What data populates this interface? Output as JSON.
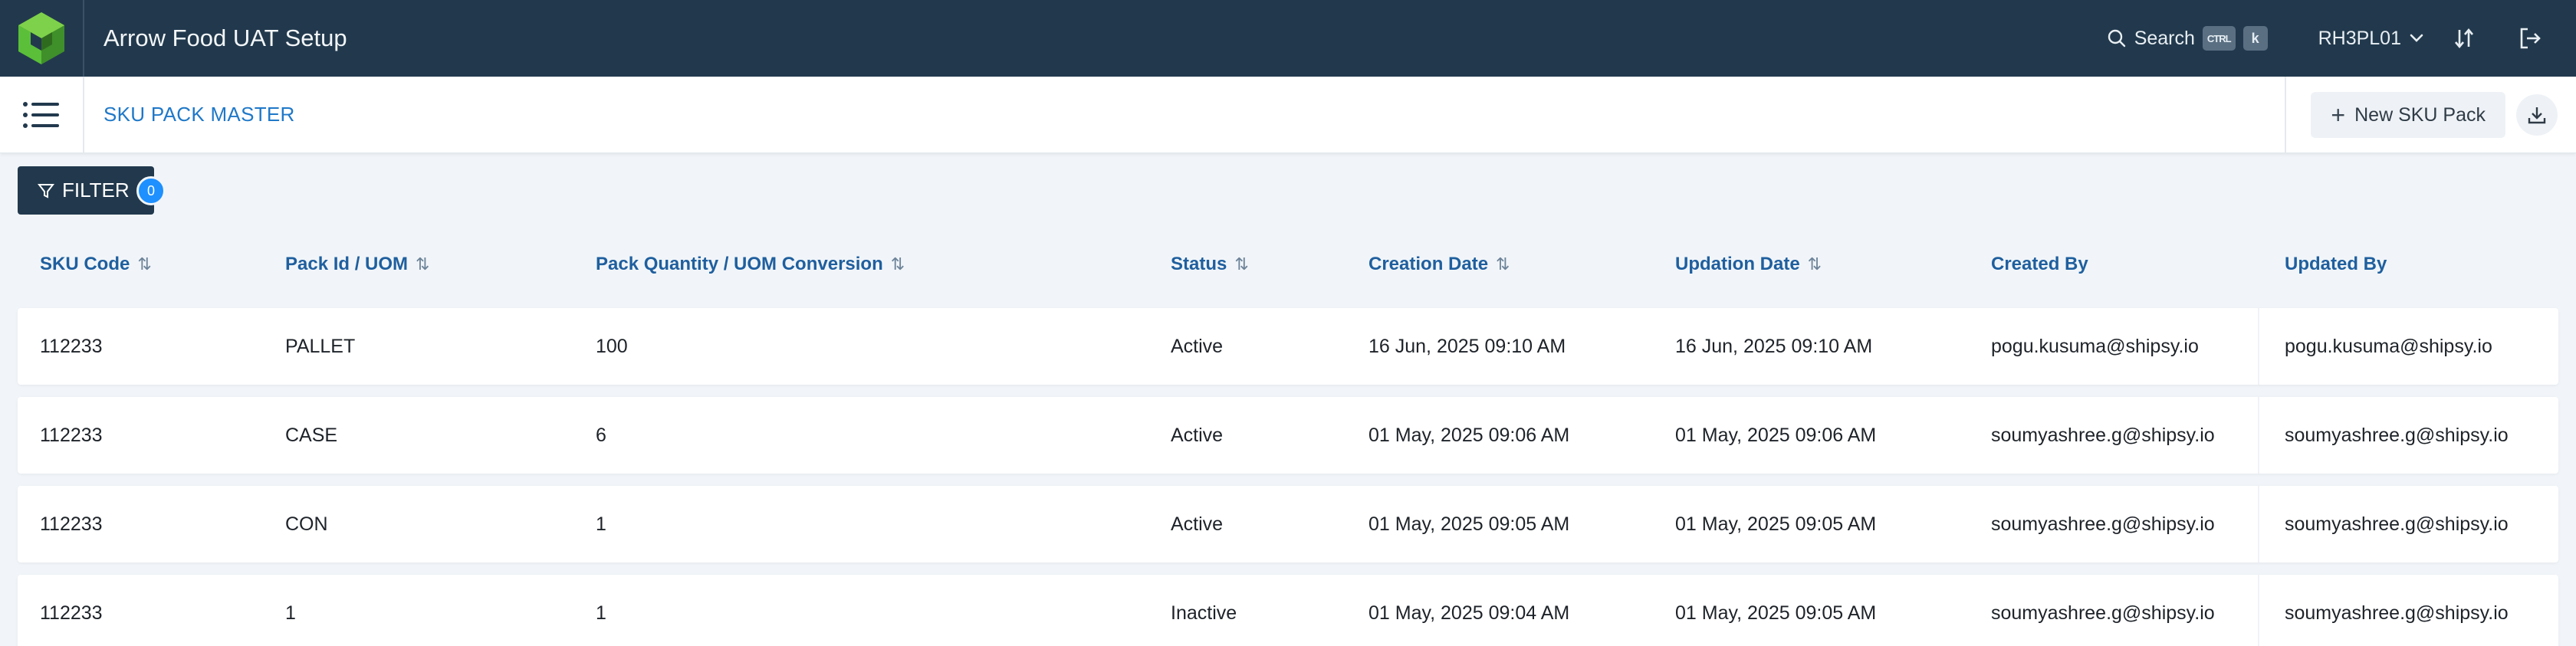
{
  "app": {
    "title": "Arrow Food UAT Setup"
  },
  "topbar": {
    "search_label": "Search",
    "shortcut_keys": [
      "CTRL",
      "k"
    ],
    "org_code": "RH3PL01"
  },
  "page": {
    "title": "SKU PACK MASTER",
    "new_button_label": "New SKU Pack"
  },
  "filter": {
    "label": "FILTER",
    "count": "0"
  },
  "table": {
    "columns": [
      "SKU Code",
      "Pack Id / UOM",
      "Pack Quantity / UOM Conversion",
      "Status",
      "Creation Date",
      "Updation Date",
      "Created By",
      "Updated By"
    ],
    "rows": [
      [
        "112233",
        "PALLET",
        "100",
        "Active",
        "16 Jun, 2025 09:10 AM",
        "16 Jun, 2025 09:10 AM",
        "pogu.kusuma@shipsy.io",
        "pogu.kusuma@shipsy.io"
      ],
      [
        "112233",
        "CASE",
        "6",
        "Active",
        "01 May, 2025 09:06 AM",
        "01 May, 2025 09:06 AM",
        "soumyashree.g@shipsy.io",
        "soumyashree.g@shipsy.io"
      ],
      [
        "112233",
        "CON",
        "1",
        "Active",
        "01 May, 2025 09:05 AM",
        "01 May, 2025 09:05 AM",
        "soumyashree.g@shipsy.io",
        "soumyashree.g@shipsy.io"
      ],
      [
        "112233",
        "1",
        "1",
        "Inactive",
        "01 May, 2025 09:04 AM",
        "01 May, 2025 09:05 AM",
        "soumyashree.g@shipsy.io",
        "soumyashree.g@shipsy.io"
      ]
    ]
  },
  "colors": {
    "topbar_bg": "#22394d",
    "accent_blue": "#1f78c8",
    "header_text": "#1f5f9e",
    "badge_blue": "#1e90ff",
    "logo_green": "#5bbf3a"
  },
  "icons": [
    "app-logo-icon",
    "search-icon",
    "chevron-down-icon",
    "sort-icon",
    "logout-icon",
    "hamburger-menu-icon",
    "plus-icon",
    "download-icon",
    "filter-icon",
    "sort-arrows-icon"
  ]
}
